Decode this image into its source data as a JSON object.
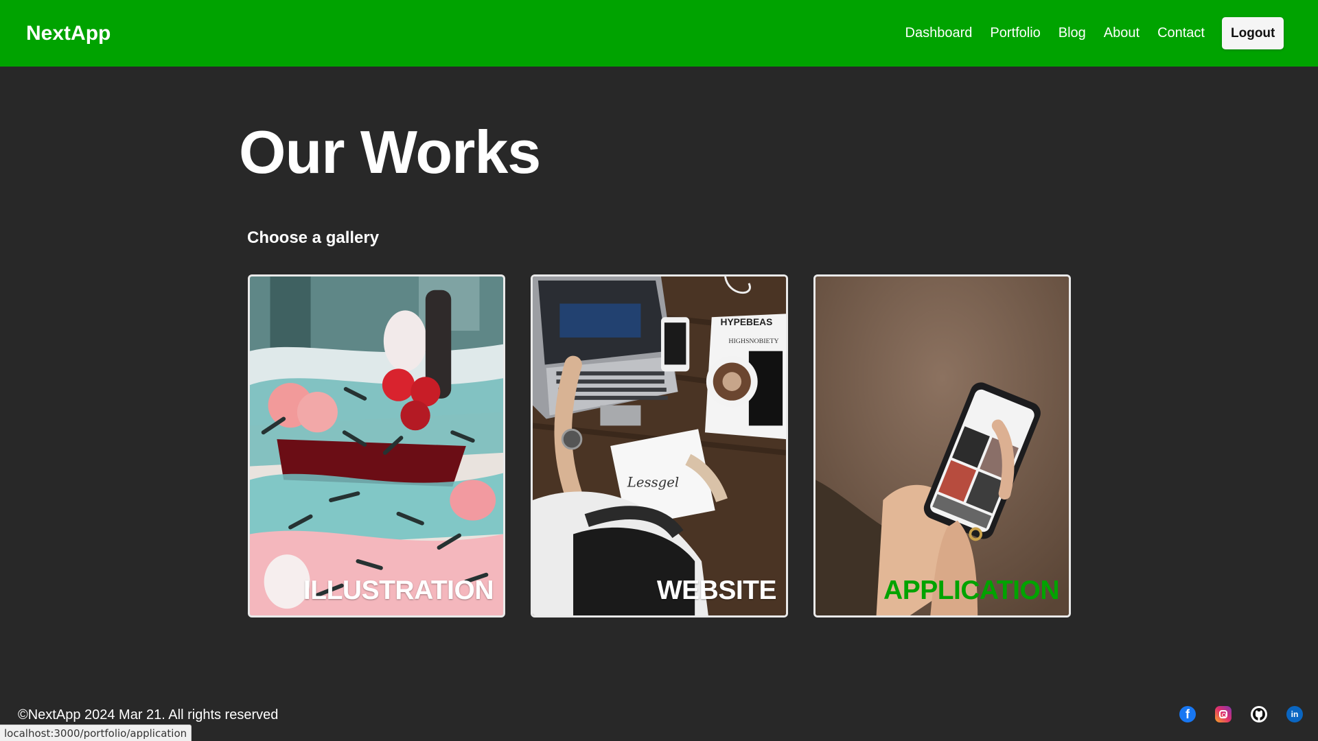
{
  "header": {
    "logo": "NextApp",
    "nav": [
      {
        "label": "Dashboard"
      },
      {
        "label": "Portfolio"
      },
      {
        "label": "Blog"
      },
      {
        "label": "About"
      },
      {
        "label": "Contact"
      }
    ],
    "logout_label": "Logout",
    "accent_color": "#00a300"
  },
  "main": {
    "title": "Our Works",
    "subtitle": "Choose a gallery",
    "galleries": [
      {
        "label": "ILLUSTRATION",
        "hovered": false
      },
      {
        "label": "WEBSITE",
        "hovered": false
      },
      {
        "label": "APPLICATION",
        "hovered": true
      }
    ]
  },
  "footer": {
    "copyright": "©NextApp 2024 Mar 21. All rights reserved",
    "social": [
      {
        "icon": "facebook-icon"
      },
      {
        "icon": "instagram-icon"
      },
      {
        "icon": "github-icon"
      },
      {
        "icon": "linkedin-icon"
      }
    ]
  },
  "status_bar": {
    "url": "localhost:3000/portfolio/application"
  },
  "colors": {
    "background": "#282828",
    "accent": "#00a300",
    "text": "#ffffff"
  }
}
